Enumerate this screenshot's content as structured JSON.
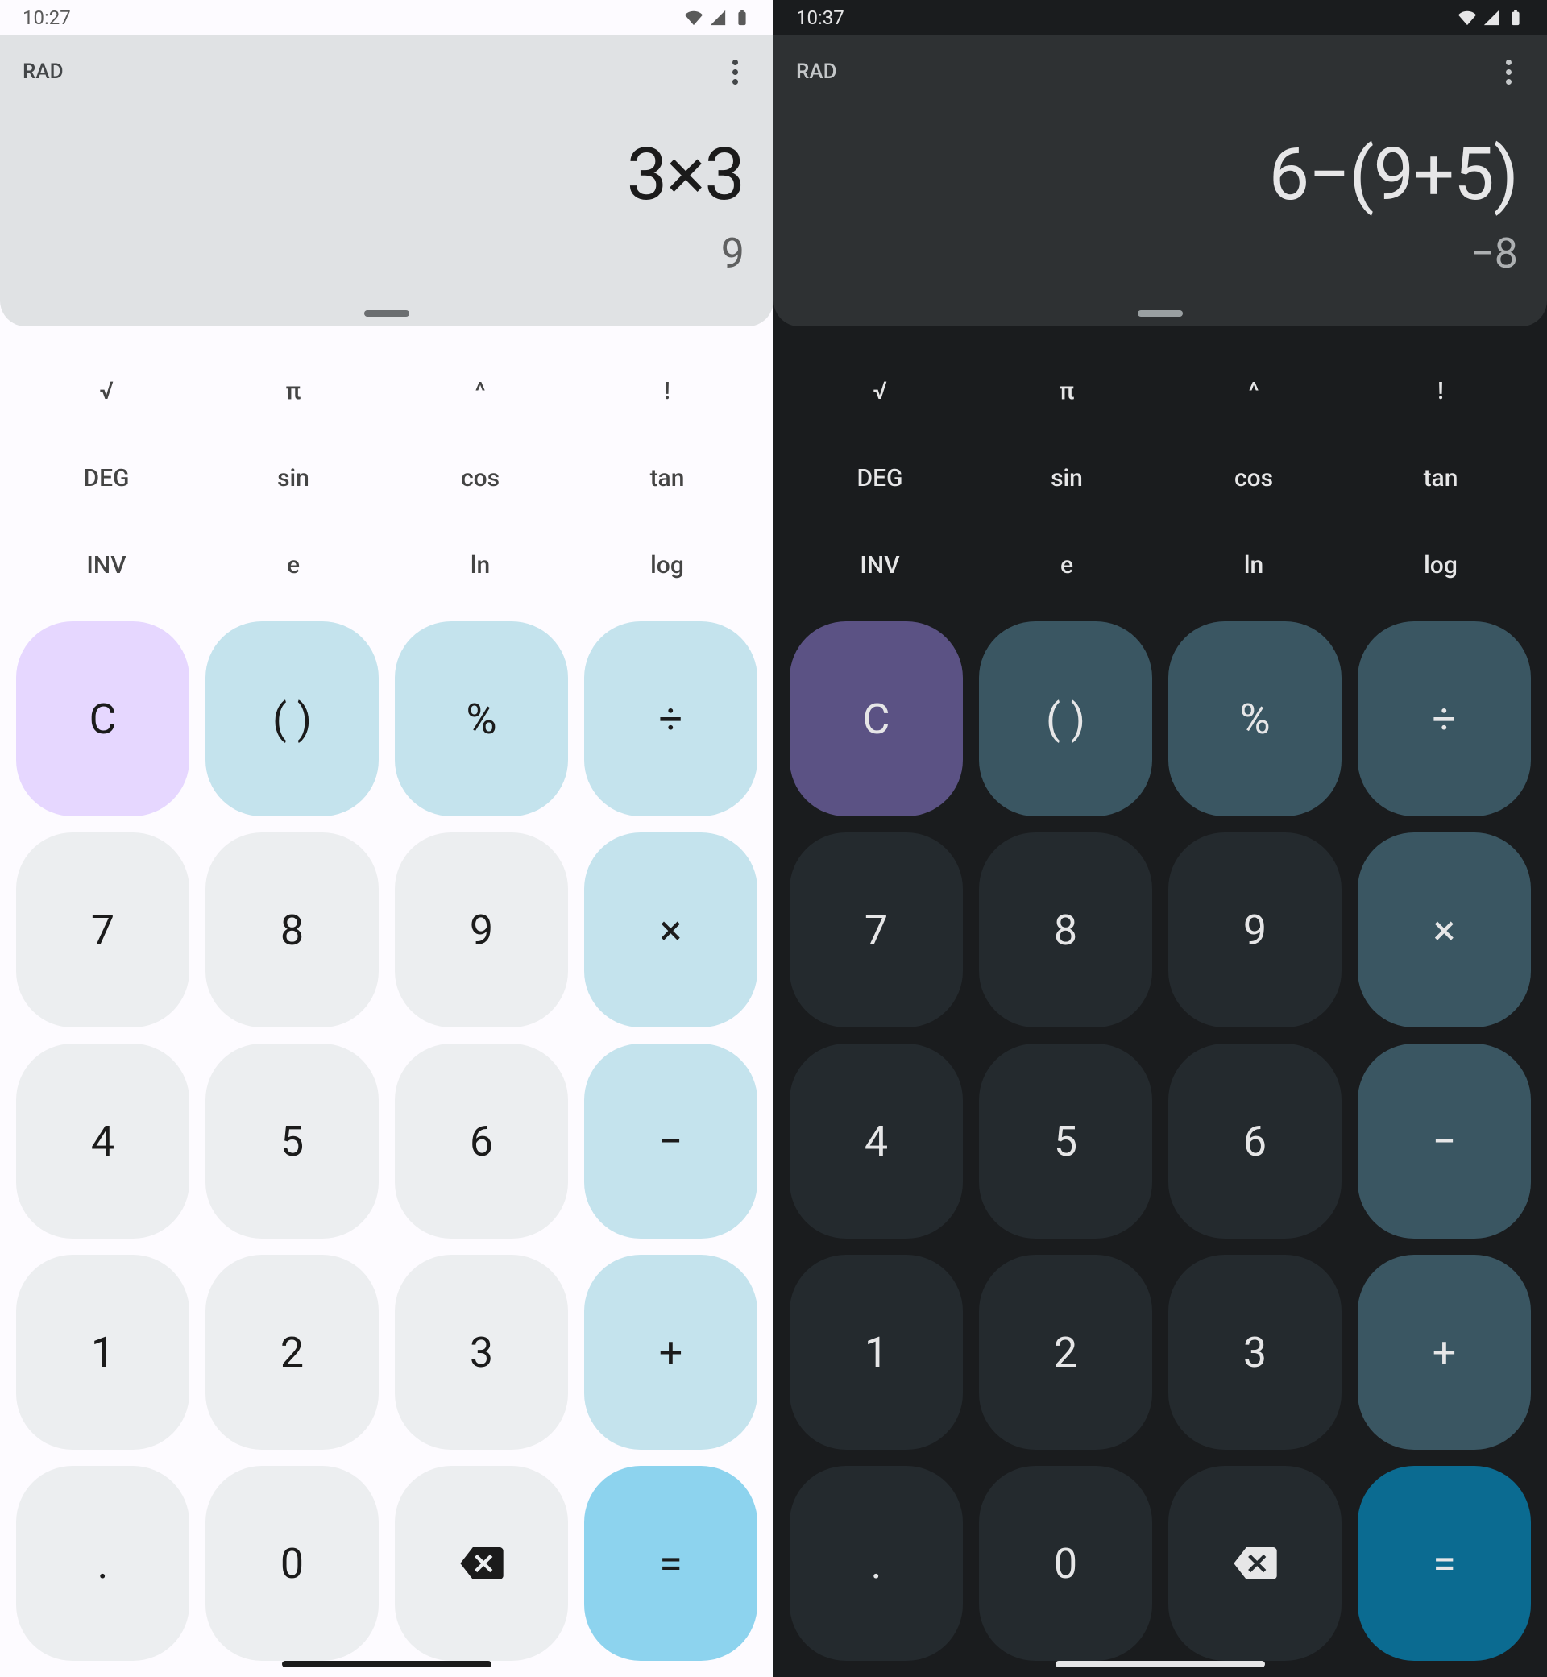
{
  "left": {
    "theme": "light",
    "status": {
      "time": "10:27"
    },
    "display": {
      "mode": "RAD",
      "expression": "3×3",
      "result": "9"
    },
    "sci": {
      "row1": [
        "√",
        "π",
        "^",
        "!"
      ],
      "row2": [
        "DEG",
        "sin",
        "cos",
        "tan"
      ],
      "row3": [
        "INV",
        "e",
        "ln",
        "log"
      ]
    },
    "keys": {
      "r0": [
        "C",
        "( )",
        "%",
        "÷"
      ],
      "r1": [
        "7",
        "8",
        "9",
        "×"
      ],
      "r2": [
        "4",
        "5",
        "6",
        "−"
      ],
      "r3": [
        "1",
        "2",
        "3",
        "+"
      ],
      "r4": [
        ".",
        "0",
        "backspace",
        "="
      ]
    }
  },
  "right": {
    "theme": "dark",
    "status": {
      "time": "10:37"
    },
    "display": {
      "mode": "RAD",
      "expression": "6−(9+5)",
      "result": "−8"
    },
    "sci": {
      "row1": [
        "√",
        "π",
        "^",
        "!"
      ],
      "row2": [
        "DEG",
        "sin",
        "cos",
        "tan"
      ],
      "row3": [
        "INV",
        "e",
        "ln",
        "log"
      ]
    },
    "keys": {
      "r0": [
        "C",
        "( )",
        "%",
        "÷"
      ],
      "r1": [
        "7",
        "8",
        "9",
        "×"
      ],
      "r2": [
        "4",
        "5",
        "6",
        "−"
      ],
      "r3": [
        "1",
        "2",
        "3",
        "+"
      ],
      "r4": [
        ".",
        "0",
        "backspace",
        "="
      ]
    }
  }
}
